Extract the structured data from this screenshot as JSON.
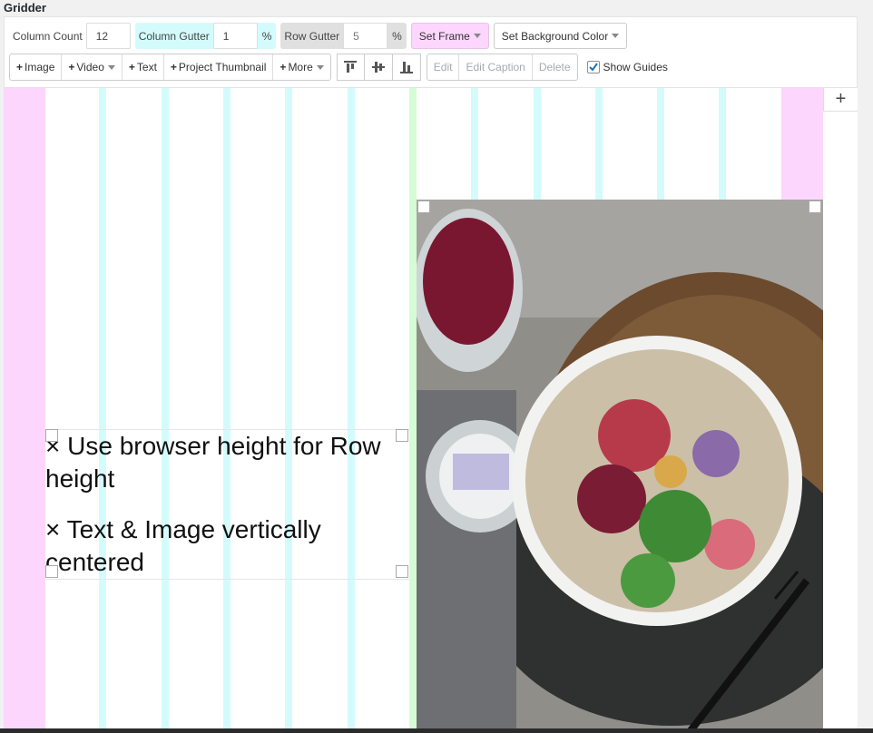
{
  "app": {
    "title": "Gridder"
  },
  "toolbar": {
    "column_count_label": "Column Count",
    "column_count_value": "12",
    "column_gutter_label": "Column Gutter",
    "column_gutter_value": "1",
    "column_gutter_unit": "%",
    "row_gutter_label": "Row Gutter",
    "row_gutter_value": "5",
    "row_gutter_unit": "%",
    "set_frame_label": "Set Frame",
    "set_bg_label": "Set Background Color",
    "add_image_label": "Image",
    "add_video_label": "Video",
    "add_text_label": "Text",
    "add_thumbnail_label": "Project Thumbnail",
    "more_label": "More",
    "edit_label": "Edit",
    "edit_caption_label": "Edit Caption",
    "delete_label": "Delete",
    "show_guides_label": "Show Guides",
    "show_guides_checked": true
  },
  "canvas": {
    "text_lines": [
      "× Use browser height for Row height",
      "× Text & Image vertically centered"
    ],
    "add_column_symbol": "+",
    "colors": {
      "frame": "#fcd6fc",
      "column_guide": "#d4fbfc",
      "center_guide": "#d6fcd6"
    }
  }
}
